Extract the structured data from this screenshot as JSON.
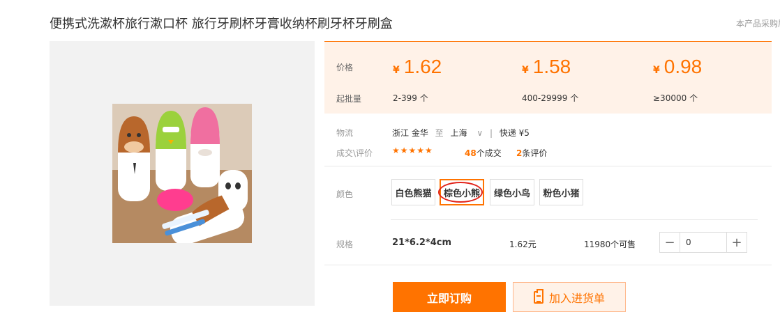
{
  "product": {
    "title": "便携式洗漱杯旅行漱口杯 旅行牙刷杯牙膏收纳杯刷牙杯牙刷盒",
    "report_link": "本产品采购属"
  },
  "pricing": {
    "price_label": "价格",
    "moq_label": "起批量",
    "currency_symbol": "¥",
    "tiers": [
      {
        "price": "1.62",
        "range": "2-399",
        "unit": "个"
      },
      {
        "price": "1.58",
        "range": "400-29999",
        "unit": "个"
      },
      {
        "price": "0.98",
        "range": "≥30000",
        "unit": "个"
      }
    ]
  },
  "logistics": {
    "label": "物流",
    "origin": "浙江 金华",
    "to": "至",
    "destination": "上海",
    "separator": "|",
    "shipping": "快递 ¥5"
  },
  "deals": {
    "label": "成交\\评价",
    "stars": "★★★★★",
    "deals_count": "48",
    "deals_text": "个成交",
    "reviews_count": "2",
    "reviews_text": "条评价"
  },
  "colors": {
    "label": "颜色",
    "options": [
      "白色熊猫",
      "棕色小熊",
      "绿色小鸟",
      "粉色小猪"
    ],
    "selected": "棕色小熊"
  },
  "spec": {
    "label": "规格",
    "size": "21*6.2*4cm",
    "price": "1.62元",
    "stock": "11980个可售",
    "minus": "−",
    "plus": "+",
    "quantity": "0"
  },
  "actions": {
    "buy_now": "立即订购",
    "add_to_list": "加入进货单"
  },
  "theme": {
    "accent": "#ff7300",
    "price_bg": "#fff2e8",
    "highlight_circle": "#e2231a"
  }
}
